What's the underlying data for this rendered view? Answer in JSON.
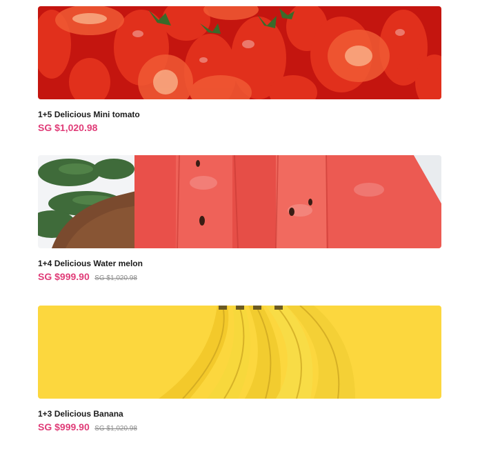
{
  "products": [
    {
      "name": "1+5 Delicious Mini tomato",
      "price": "SG $1,020.98",
      "old_price": "",
      "image": "tomato-photo"
    },
    {
      "name": "1+4 Delicious Water melon",
      "price": "SG $999.90",
      "old_price": "SG $1,020.98",
      "image": "watermelon-photo"
    },
    {
      "name": "1+3 Delicious Banana",
      "price": "SG $999.90",
      "old_price": "SG $1,020.98",
      "image": "banana-photo"
    }
  ],
  "colors": {
    "price": "#e03c78",
    "name": "#1a1a1a",
    "old_price": "#8a8a8a"
  }
}
